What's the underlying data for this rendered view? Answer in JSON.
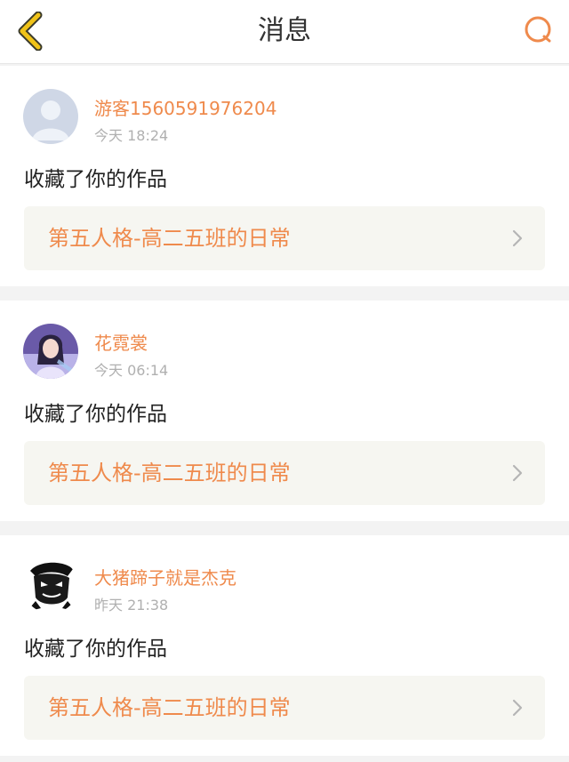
{
  "header": {
    "title": "消息",
    "back_icon": "chevron-left-icon",
    "search_icon": "search-icon",
    "accent_color": "#ef8a4c",
    "back_color": "#f0c319"
  },
  "notifications": [
    {
      "username": "游客1560591976204",
      "time": "今天 18:24",
      "action": "收藏了你的作品",
      "work_title": "第五人格-高二五班的日常",
      "avatar": "default-user-avatar"
    },
    {
      "username": "花霓裳",
      "time": "今天 06:14",
      "action": "收藏了你的作品",
      "work_title": "第五人格-高二五班的日常",
      "avatar": "anime-girl-avatar"
    },
    {
      "username": "大猪蹄子就是杰克",
      "time": "昨天 21:38",
      "action": "收藏了你的作品",
      "work_title": "第五人格-高二五班的日常",
      "avatar": "masked-figure-avatar"
    }
  ]
}
